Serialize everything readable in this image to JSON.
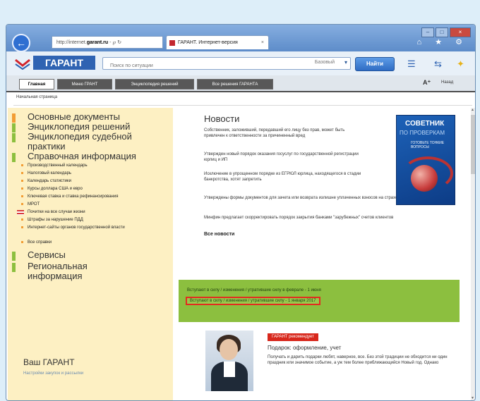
{
  "browser": {
    "address": {
      "prefix": "http://internet.",
      "domain": "garant.ru",
      "suffix": " - ℘ ↻"
    },
    "tab": {
      "label": "ГАРАНТ. Интернет-версия",
      "close": "×"
    },
    "window_controls": [
      "–",
      "□",
      "×"
    ],
    "tool_icons": "⌂ ★ ⚙",
    "back_icon": "back-arrow-icon"
  },
  "app": {
    "brand": "ГАРАНТ",
    "search_placeholder": "Поиск по ситуации",
    "search_scope": "Базовый",
    "find_label": "Найти",
    "aa_label": "A⁺",
    "back_label": "Назад",
    "tabs": [
      {
        "label": "Главная",
        "active": true
      },
      {
        "label": "Меню ГРАНТ",
        "active": false
      },
      {
        "label": "Энциклопедия решений",
        "active": false
      },
      {
        "label": "Все решения ГАРАНТА",
        "active": false
      }
    ],
    "breadcrumb": "Начальная страница"
  },
  "left": {
    "sections_top": [
      {
        "label": "Основные документы",
        "color": "#f29d34"
      },
      {
        "label": "Энциклопедия решений",
        "color": "#8cbf3f"
      },
      {
        "label": "Энциклопедия судебной практики",
        "color": "#8cbf3f"
      },
      {
        "label": "Справочная информация",
        "color": "#8cbf3f"
      }
    ],
    "items": [
      {
        "label": "Производственный календарь",
        "marker": "bullet"
      },
      {
        "label": "Налоговый календарь",
        "marker": "bullet"
      },
      {
        "label": "Календарь статистики",
        "marker": "bullet"
      },
      {
        "label": "Курсы доллара США и евро",
        "marker": "bullet"
      },
      {
        "label": "Ключевая ставка и ставка рефинансирования",
        "marker": "bullet"
      },
      {
        "label": "МРОТ",
        "marker": "bullet"
      },
      {
        "label": "Почитки на все случаи жизни",
        "marker": "flag"
      },
      {
        "label": "Штрафы за нарушение ПДД",
        "marker": "bullet"
      },
      {
        "label": "Интернет-сайты органов государственной власти",
        "marker": "bullet"
      },
      {
        "label": "Все справки",
        "marker": "bullet"
      }
    ],
    "sections_bottom": [
      {
        "label": "Сервисы",
        "color": "#8cbf3f"
      },
      {
        "label": "Региональная информация",
        "color": "#8cbf3f"
      }
    ],
    "vas": {
      "title": "Ваш ГАРАНТ",
      "subtitle": "Настройки закупок и рассылки"
    }
  },
  "news": {
    "title": "Новости",
    "items": [
      "Собственник, заложивший, передавший его лицу без прав, может быть привлечен к ответственности за причиненный вред",
      "Утвержден новый порядок оказания госуслуг по государственной регистрации юрлиц и ИП",
      "Исключение в упрощенном порядке из ЕГРЮЛ юрлица, находящегося в стадии банкротства, хотят запретить",
      "Утверждены формы документов для зачета или возврата излишне уплаченных взносов на страхование по \"травматизму\"",
      "Минфин предлагает скорректировать порядок закрытия банками \"зарубежных\" счетов клиентов"
    ],
    "all_label": "Все новости"
  },
  "promo": {
    "title": "СОВЕТНИК",
    "subtitle": "ПО ПРОВЕРКАМ",
    "note": "ГОТОВЬТЕ ТОНКИЕ ВОПРОСЫ"
  },
  "green_block": {
    "line1": "Вступают в силу / изменения / утратившие силу в феврале - 1 июня",
    "line2": "Вступают в силу / изменения / утратившие силу - 1 января 2017",
    "highlight_color": "#e32b1f"
  },
  "feature": {
    "badge": "ГАРАНТ рекомендует",
    "title": "Подарок: оформление, учет",
    "text": "Получать и дарить подарки любят, наверное, все. Без этой традиции не обходится ни один праздник или значимое событие, а уж тем более приближающийся Новый год. Однако"
  }
}
